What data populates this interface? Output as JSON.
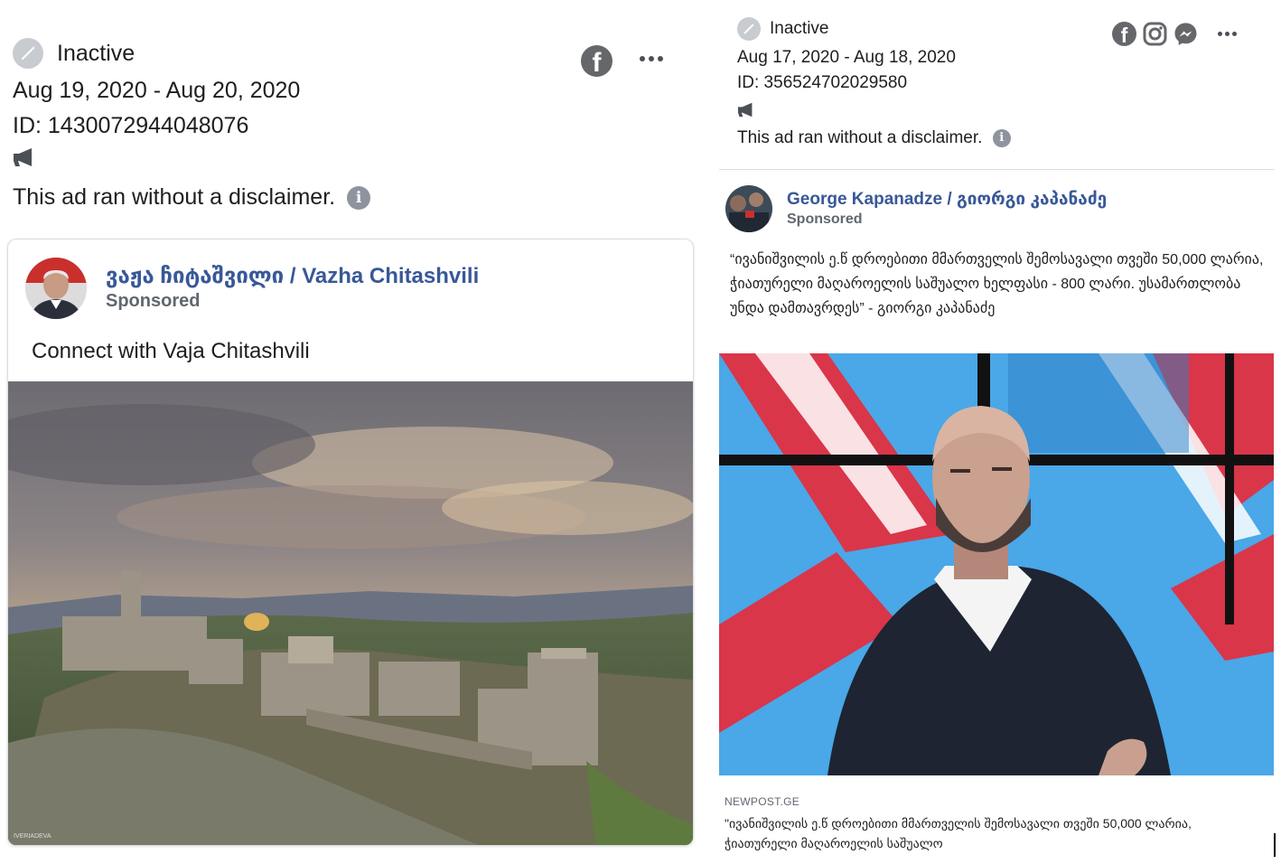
{
  "left_ad": {
    "status": "Inactive",
    "date_range": "Aug 19, 2020 - Aug 20, 2020",
    "id": "ID: 1430072944048076",
    "disclaimer": "This ad ran without a disclaimer.",
    "platform_icons": [
      "facebook-icon"
    ],
    "menu_icon": "more-icon",
    "page_name": "ვაჟა ჩიტაშვილი / Vazha Chitashvili",
    "sponsored": "Sponsored",
    "body_text": "Connect with Vaja Chitashvili",
    "image_watermark": "IVERIADEVA"
  },
  "right_ad": {
    "status": "Inactive",
    "date_range": "Aug 17, 2020 - Aug 18, 2020",
    "id": "ID: 356524702029580",
    "disclaimer": "This ad ran without a disclaimer.",
    "platform_icons": [
      "facebook-icon",
      "instagram-icon",
      "messenger-icon"
    ],
    "menu_icon": "more-icon",
    "page_name": "George Kapanadze / გიორგი კაპანაძე",
    "sponsored": "Sponsored",
    "body_text": "“ივანიშვილის ე.წ დროებითი მმართველის შემოსავალი თვეში 50,000 ლარია, ჭიათურელი მაღაროელის საშუალო ხელფასი - 800 ლარი. უსამართლობა უნდა დამთავრდეს” - გიორგი კაპანაძე",
    "link_domain": "NEWPOST.GE",
    "link_title": "\"ივანიშვილის ე.წ დროებითი მმართველის შემოსავალი თვეში 50,000 ლარია, ჭიათურელი მაღაროელის საშუალო"
  },
  "colors": {
    "page_name": "#385898",
    "sponsored": "#616770",
    "status_icon": "#c8ccd1",
    "icon_gray": "#65676b"
  }
}
